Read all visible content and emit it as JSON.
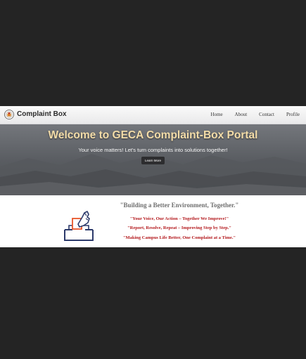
{
  "navbar": {
    "brand": "Complaint Box",
    "links": [
      "Home",
      "About",
      "Contact",
      "Profile"
    ]
  },
  "hero": {
    "title": "Welcome to GECA Complaint-Box Portal",
    "subtitle": "Your voice matters! Let's turn complaints into solutions together!",
    "button_label": "Learn More"
  },
  "lower": {
    "tagline": "\"Building a Better Environment, Together.\"",
    "slogans": [
      "\"Your Voice, Our Action – Together We Improve!\"",
      "\"Report, Resolve, Repeat – Improving Step by Step.\"",
      "\"Making Campus Life Better, One Complaint at a Time.\""
    ]
  },
  "colors": {
    "page_background": "#242424",
    "hero_title": "#f3dca8",
    "slogan_red": "#b3171b",
    "tagline_gray": "#6f6f6f",
    "ballot_navy": "#2c3a6b",
    "ballot_orange": "#e8552a"
  },
  "icons": {
    "logo": "complaint-box-logo-icon",
    "ballot": "ballot-box-hand-icon"
  }
}
